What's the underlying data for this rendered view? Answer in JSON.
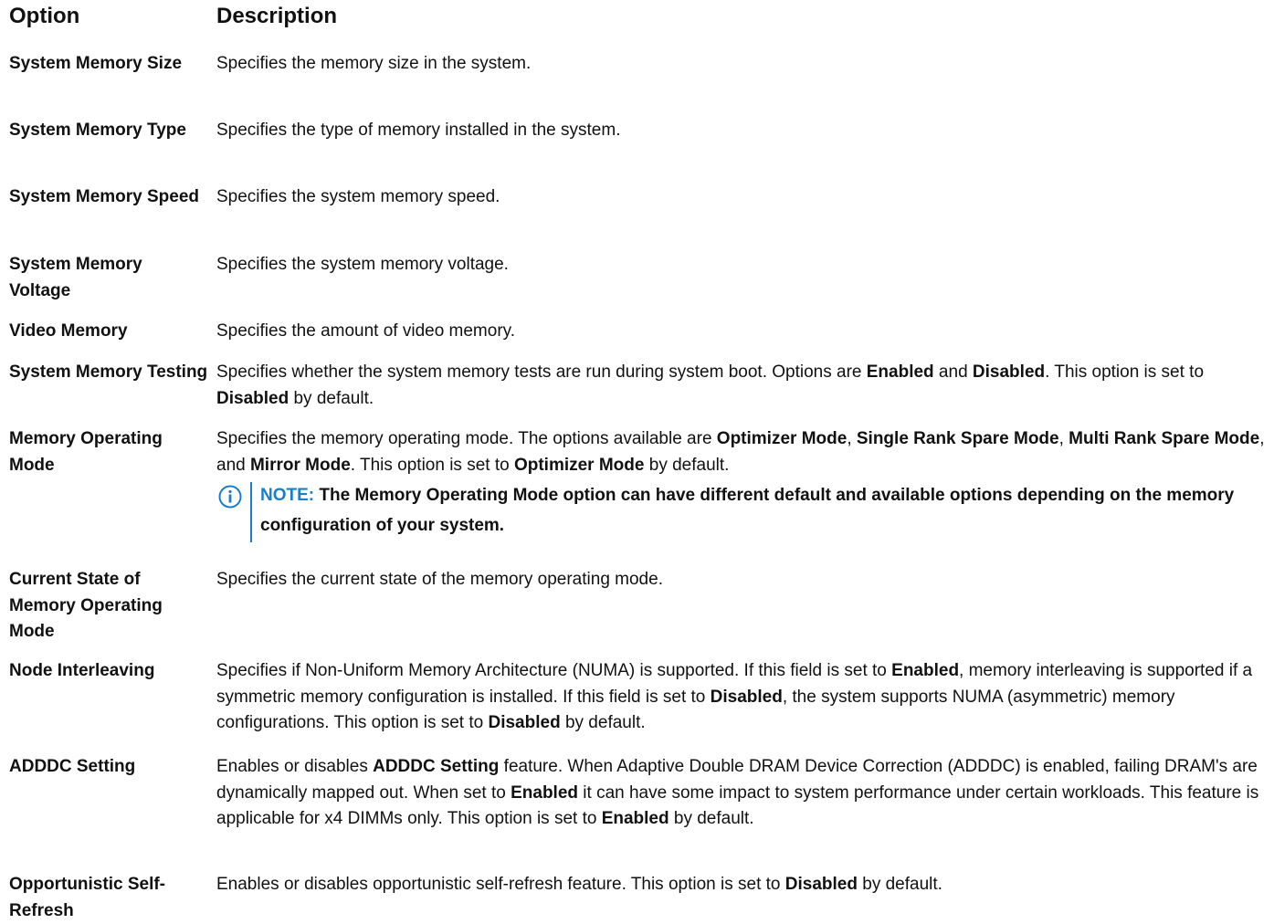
{
  "header": {
    "option": "Option",
    "description": "Description"
  },
  "rows": [
    {
      "option": "System Memory Size",
      "desc": [
        {
          "t": "Specifies the memory size in the system."
        }
      ]
    },
    {
      "option": "System Memory Type",
      "desc": [
        {
          "t": "Specifies the type of memory installed in the system."
        }
      ]
    },
    {
      "option": "System Memory Speed",
      "desc": [
        {
          "t": "Specifies the system memory speed."
        }
      ]
    },
    {
      "option": "System Memory Voltage",
      "desc": [
        {
          "t": "Specifies the system memory voltage."
        }
      ]
    },
    {
      "option": "Video Memory",
      "desc": [
        {
          "t": "Specifies the amount of video memory."
        }
      ]
    },
    {
      "option": "System Memory Testing",
      "desc": [
        {
          "t": "Specifies whether the system memory tests are run during system boot. Options are "
        },
        {
          "t": "Enabled",
          "b": true
        },
        {
          "t": " and "
        },
        {
          "t": "Disabled",
          "b": true
        },
        {
          "t": ". This option is set to "
        },
        {
          "t": "Disabled",
          "b": true
        },
        {
          "t": " by default."
        }
      ]
    },
    {
      "option": "Memory Operating Mode",
      "desc": [
        {
          "t": "Specifies the memory operating mode. The options available are "
        },
        {
          "t": "Optimizer Mode",
          "b": true
        },
        {
          "t": ", "
        },
        {
          "t": "Single Rank Spare Mode",
          "b": true
        },
        {
          "t": ", "
        },
        {
          "t": "Multi Rank Spare Mode",
          "b": true
        },
        {
          "t": ", and "
        },
        {
          "t": "Mirror Mode",
          "b": true
        },
        {
          "t": ". This option is set to "
        },
        {
          "t": "Optimizer Mode",
          "b": true
        },
        {
          "t": " by default."
        }
      ],
      "note": {
        "label": "NOTE:",
        "text": " The Memory Operating Mode option can have different default and available options depending on the memory configuration of your system.",
        "icon": "info-icon",
        "color": "#1a7ec8"
      }
    },
    {
      "option": "Current State of Memory Operating Mode",
      "desc": [
        {
          "t": "Specifies the current state of the memory operating mode."
        }
      ]
    },
    {
      "option": "Node Interleaving",
      "desc": [
        {
          "t": "Specifies if Non-Uniform Memory Architecture (NUMA) is supported. If this field is set to "
        },
        {
          "t": "Enabled",
          "b": true
        },
        {
          "t": ", memory interleaving is supported if a symmetric memory configuration is installed. If this field is set to "
        },
        {
          "t": "Disabled",
          "b": true
        },
        {
          "t": ", the system supports NUMA (asymmetric) memory configurations. This option is set to "
        },
        {
          "t": "Disabled",
          "b": true
        },
        {
          "t": " by default."
        }
      ]
    },
    {
      "option": "ADDDC Setting",
      "desc": [
        {
          "t": "Enables or disables "
        },
        {
          "t": "ADDDC Setting",
          "b": true
        },
        {
          "t": " feature. When Adaptive Double DRAM Device Correction (ADDDC) is enabled, failing DRAM's are dynamically mapped out. When set to "
        },
        {
          "t": "Enabled",
          "b": true
        },
        {
          "t": " it can have some impact to system performance under certain workloads. This feature is applicable for x4 DIMMs only. This option is set to "
        },
        {
          "t": "Enabled",
          "b": true
        },
        {
          "t": " by default."
        }
      ]
    },
    {
      "option": "Opportunistic Self-Refresh",
      "desc": [
        {
          "t": "Enables or disables opportunistic self-refresh feature. This option is set to "
        },
        {
          "t": "Disabled",
          "b": true
        },
        {
          "t": " by default."
        }
      ]
    }
  ]
}
